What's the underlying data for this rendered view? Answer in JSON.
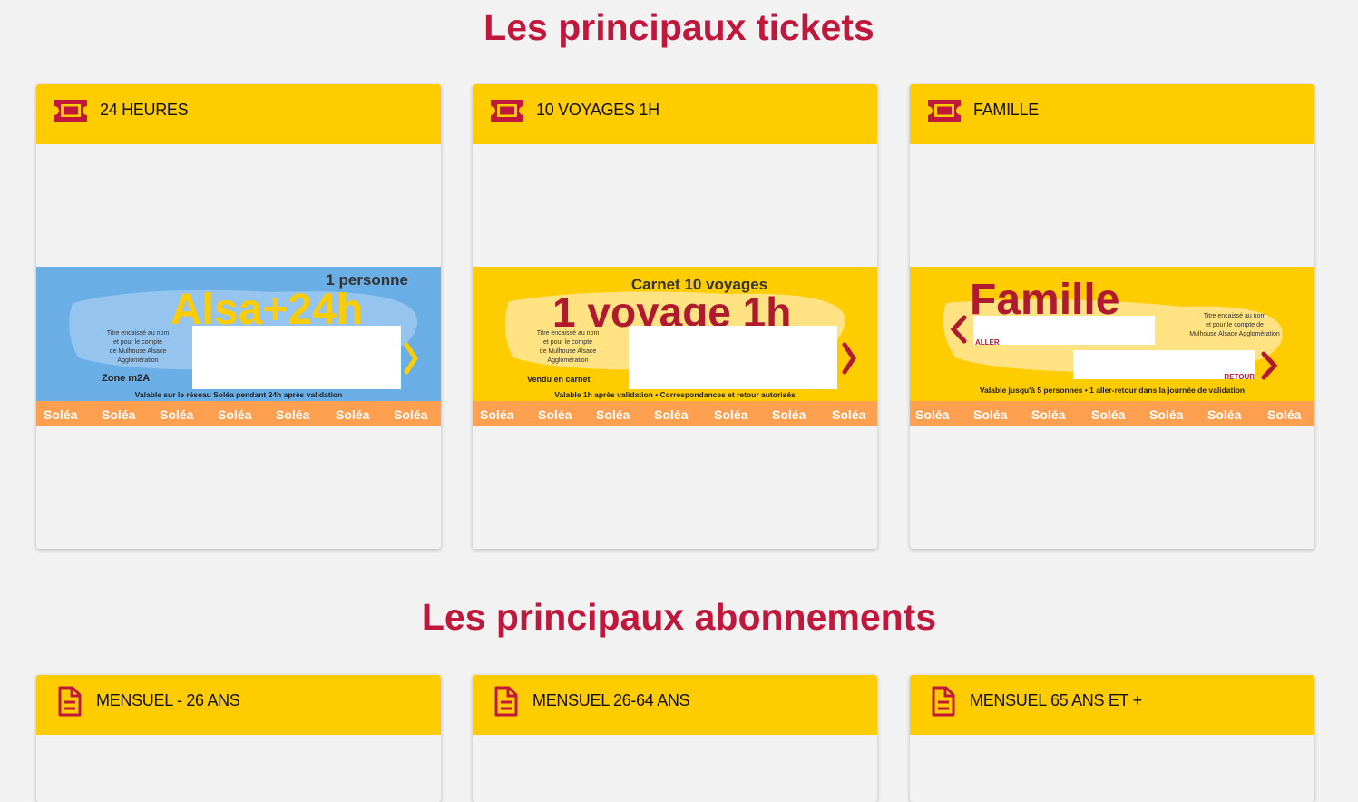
{
  "sections": {
    "tickets": {
      "title": "Les principaux tickets",
      "cards": [
        {
          "label": "24 HEURES",
          "icon": "ticket-icon",
          "image": {
            "bg": "#6aaee6",
            "top_text": "1 personne",
            "big_text": "Alsa+24h",
            "small_text": [
              "Titre encaissé au nom",
              "et pour le compte",
              "de Mulhouse Alsace",
              "Agglomération"
            ],
            "zone": "Zone m2A",
            "footer": "Valable sur le réseau Soléa pendant 24h après validation",
            "brand": "Soléa"
          }
        },
        {
          "label": "10 VOYAGES 1H",
          "icon": "ticket-icon",
          "image": {
            "bg": "#ffcc00",
            "top_text": "Carnet 10 voyages",
            "big_text": "1 voyage 1h",
            "small_text": [
              "Titre encaissé au nom",
              "et pour le compte",
              "de Mulhouse Alsace",
              "Agglomération"
            ],
            "zone": "Vendu en carnet",
            "footer": "Valable 1h après validation • Correspondances et retour autorisés",
            "brand": "Soléa"
          }
        },
        {
          "label": "FAMILLE",
          "icon": "ticket-icon",
          "image": {
            "bg": "#ffcc00",
            "big_text": "Famille",
            "aller": "ALLER",
            "retour": "RETOUR",
            "small_text": [
              "Titre encaissé au nom",
              "et pour le compte de",
              "Mulhouse Alsace Agglomération"
            ],
            "footer": "Valable jusqu'à 5 personnes • 1 aller-retour dans la journée de validation",
            "brand": "Soléa"
          }
        }
      ]
    },
    "subscriptions": {
      "title": "Les principaux abonnements",
      "cards": [
        {
          "label": "MENSUEL - 26 ANS",
          "icon": "document-icon"
        },
        {
          "label": "MENSUEL 26-64 ANS",
          "icon": "document-icon"
        },
        {
          "label": "MENSUEL 65 ANS ET +",
          "icon": "document-icon"
        }
      ]
    }
  },
  "colors": {
    "accent": "#c0183c",
    "header_yellow": "#ffcc00",
    "orange_band": "#ffa050",
    "background": "#f2f2f2"
  }
}
